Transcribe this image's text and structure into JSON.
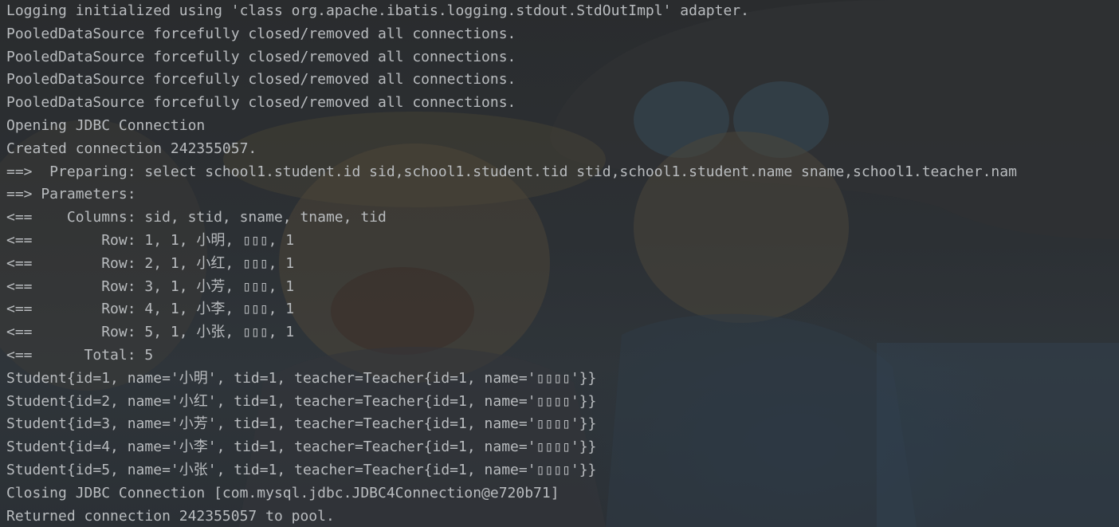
{
  "console": {
    "lines": [
      "Logging initialized using 'class org.apache.ibatis.logging.stdout.StdOutImpl' adapter.",
      "PooledDataSource forcefully closed/removed all connections.",
      "PooledDataSource forcefully closed/removed all connections.",
      "PooledDataSource forcefully closed/removed all connections.",
      "PooledDataSource forcefully closed/removed all connections.",
      "Opening JDBC Connection",
      "Created connection 242355057.",
      "==>  Preparing: select school1.student.id sid,school1.student.tid stid,school1.student.name sname,school1.teacher.nam",
      "==> Parameters: ",
      "<==    Columns: sid, stid, sname, tname, tid",
      "<==        Row: 1, 1, 小明, ▯▯▯, 1",
      "<==        Row: 2, 1, 小红, ▯▯▯, 1",
      "<==        Row: 3, 1, 小芳, ▯▯▯, 1",
      "<==        Row: 4, 1, 小李, ▯▯▯, 1",
      "<==        Row: 5, 1, 小张, ▯▯▯, 1",
      "<==      Total: 5",
      "Student{id=1, name='小明', tid=1, teacher=Teacher{id=1, name='▯▯▯▯'}}",
      "Student{id=2, name='小红', tid=1, teacher=Teacher{id=1, name='▯▯▯▯'}}",
      "Student{id=3, name='小芳', tid=1, teacher=Teacher{id=1, name='▯▯▯▯'}}",
      "Student{id=4, name='小李', tid=1, teacher=Teacher{id=1, name='▯▯▯▯'}}",
      "Student{id=5, name='小张', tid=1, teacher=Teacher{id=1, name='▯▯▯▯'}}",
      "Closing JDBC Connection [com.mysql.jdbc.JDBC4Connection@e720b71]",
      "Returned connection 242355057 to pool."
    ]
  },
  "colors": {
    "text": "#b9bcbf",
    "background": "#2b2d2f"
  }
}
